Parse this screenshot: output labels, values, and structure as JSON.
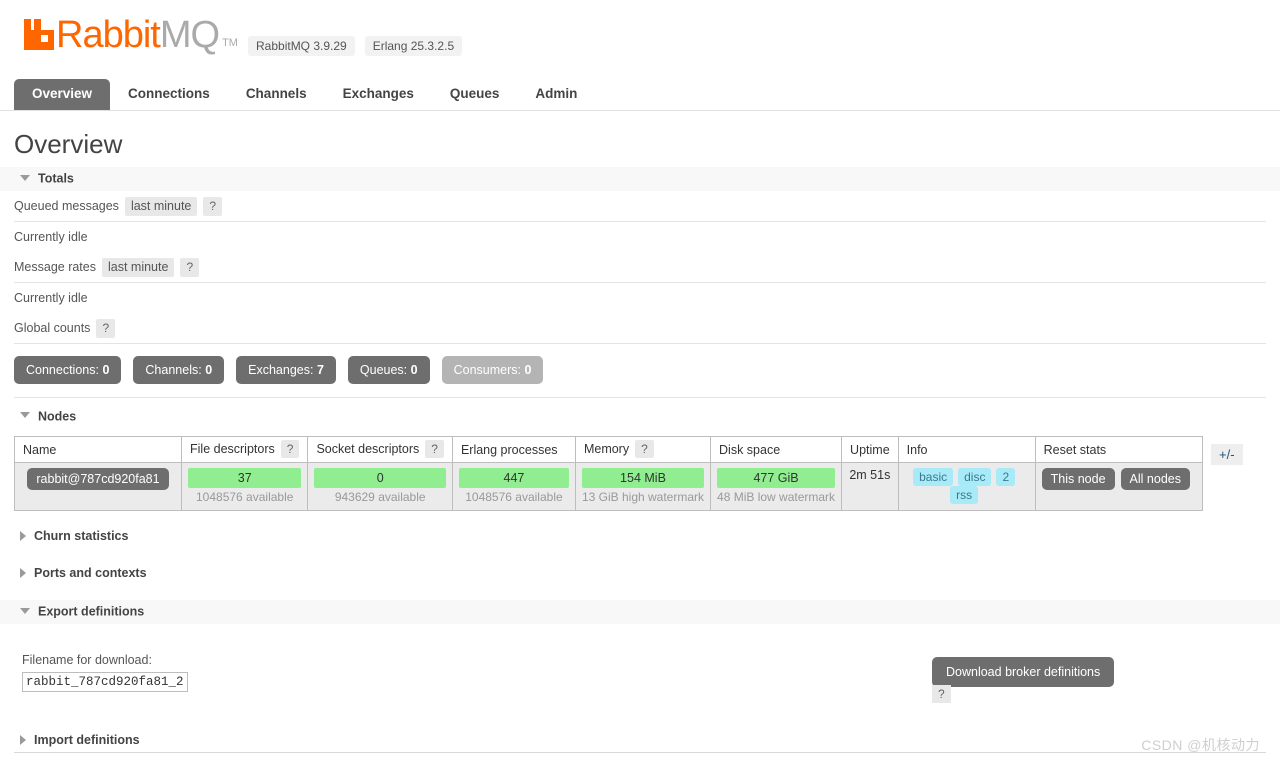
{
  "header": {
    "logo_rabbit": "Rabbit",
    "logo_mq": "MQ",
    "logo_tm": "TM",
    "version_badges": [
      "RabbitMQ 3.9.29",
      "Erlang 25.3.2.5"
    ]
  },
  "nav": {
    "tabs": [
      {
        "label": "Overview",
        "active": true
      },
      {
        "label": "Connections",
        "active": false
      },
      {
        "label": "Channels",
        "active": false
      },
      {
        "label": "Exchanges",
        "active": false
      },
      {
        "label": "Queues",
        "active": false
      },
      {
        "label": "Admin",
        "active": false
      }
    ]
  },
  "page": {
    "title": "Overview"
  },
  "totals": {
    "section_label": "Totals",
    "queued_messages_label": "Queued messages",
    "queued_messages_range": "last minute",
    "queued_messages_idle": "Currently idle",
    "message_rates_label": "Message rates",
    "message_rates_range": "last minute",
    "message_rates_idle": "Currently idle",
    "global_counts_label": "Global counts",
    "help": "?",
    "counts": [
      {
        "label": "Connections:",
        "value": "0",
        "muted": false
      },
      {
        "label": "Channels:",
        "value": "0",
        "muted": false
      },
      {
        "label": "Exchanges:",
        "value": "7",
        "muted": false
      },
      {
        "label": "Queues:",
        "value": "0",
        "muted": false
      },
      {
        "label": "Consumers:",
        "value": "0",
        "muted": true
      }
    ]
  },
  "nodes": {
    "section_label": "Nodes",
    "columns": [
      {
        "label": "Name",
        "help": false
      },
      {
        "label": "File descriptors",
        "help": true
      },
      {
        "label": "Socket descriptors",
        "help": true
      },
      {
        "label": "Erlang processes",
        "help": false
      },
      {
        "label": "Memory",
        "help": true
      },
      {
        "label": "Disk space",
        "help": false
      },
      {
        "label": "Uptime",
        "help": false
      },
      {
        "label": "Info",
        "help": false
      },
      {
        "label": "Reset stats",
        "help": false
      }
    ],
    "row": {
      "name": "rabbit@787cd920fa81",
      "file_descriptors": {
        "value": "37",
        "note": "1048576 available"
      },
      "socket_descriptors": {
        "value": "0",
        "note": "943629 available"
      },
      "erlang_processes": {
        "value": "447",
        "note": "1048576 available"
      },
      "memory": {
        "value": "154 MiB",
        "note": "13 GiB high watermark"
      },
      "disk_space": {
        "value": "477 GiB",
        "note": "48 MiB low watermark"
      },
      "uptime": "2m 51s",
      "info_tags": [
        "basic",
        "disc",
        "2",
        "rss"
      ],
      "reset_buttons": [
        "This node",
        "All nodes"
      ]
    },
    "toggle_columns": "+/-"
  },
  "sections": {
    "churn_statistics": "Churn statistics",
    "ports_and_contexts": "Ports and contexts",
    "export_definitions": "Export definitions",
    "import_definitions": "Import definitions"
  },
  "export": {
    "filename_label": "Filename for download:",
    "filename_value": "rabbit_787cd920fa81_2",
    "download_button": "Download broker definitions",
    "help": "?"
  },
  "watermark": {
    "text": "CSDN @机核动力"
  },
  "colors": {
    "brand_orange": "#ff6600",
    "dark_gray": "#6e6e6e",
    "green_bar": "#90ee90",
    "info_tag": "#a9eaf8"
  }
}
